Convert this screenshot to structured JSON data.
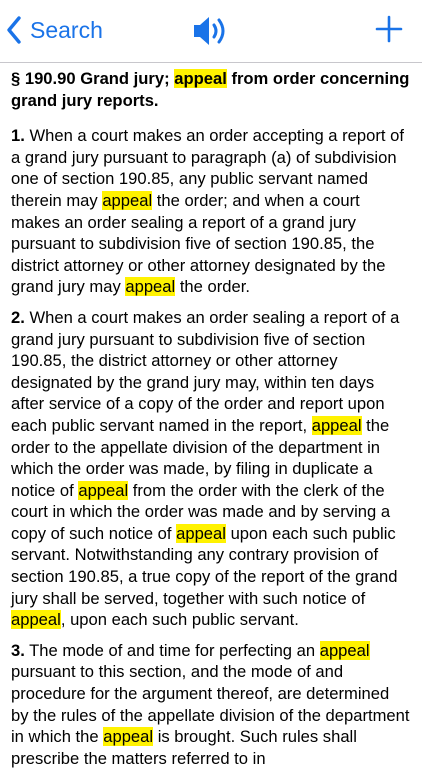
{
  "nav": {
    "back_label": "Search",
    "accent_color": "#1a73e8",
    "icons": {
      "back": "chevron-left-icon",
      "speaker": "speaker-icon",
      "add": "plus-icon"
    }
  },
  "highlight_color": "#fff200",
  "section": {
    "title_pre": "§ 190.90 Grand jury; ",
    "title_hl": "appeal",
    "title_post": " from order concerning grand jury reports."
  },
  "paragraphs": {
    "p1": {
      "num": "1.",
      "s1": " When a court makes an order accepting a report of a grand jury pursuant to paragraph (a) of subdivision one of section 190.85, any public servant named therein may ",
      "h1": "appeal",
      "s2": " the order; and when a court makes an order sealing a report of a grand jury pursuant to subdivision five of section 190.85, the district attorney or other attorney designated by the grand jury may ",
      "h2": "appeal",
      "s3": " the order."
    },
    "p2": {
      "num": "2.",
      "s1": " When a court makes an order sealing a report of a grand jury pursuant to subdivision five of section 190.85, the district attorney or other attorney designated by the grand jury may, within ten days after service of a copy of the order and report upon each public servant named in the report, ",
      "h1": "appeal",
      "s2": " the order to the appellate division of the department in which the order was made, by filing in duplicate a notice of ",
      "h2": "appeal",
      "s3": " from the order with the clerk of the court in which the order was made and by serving a copy of such notice of ",
      "h3": "appeal",
      "s4": " upon each such public servant. Notwithstanding any contrary provision of section 190.85, a true copy of the report of the grand jury shall be served, together with such notice of ",
      "h4": "appeal",
      "s5": ", upon each such public servant."
    },
    "p3": {
      "num": "3.",
      "s1": " The mode of and time for perfecting an ",
      "h1": "appeal",
      "s2": " pursuant to this section, and the mode of and procedure for the argument thereof, are determined by the rules of the appellate division of the department in which the ",
      "h2": "appeal",
      "s3": " is brought. Such rules shall prescribe the matters referred to in"
    }
  }
}
